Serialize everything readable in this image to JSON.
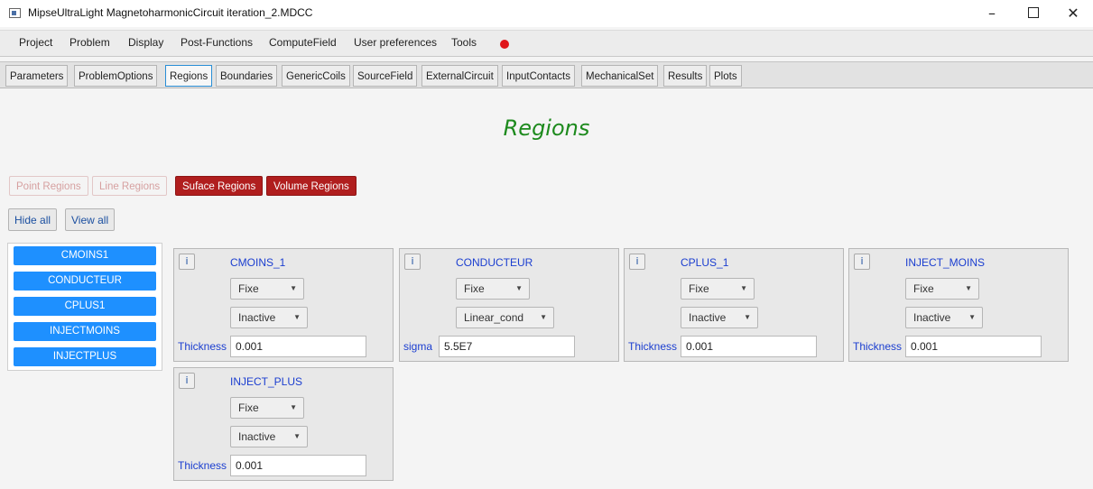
{
  "window": {
    "title": "MipseUltraLight MagnetoharmonicCircuit iteration_2.MDCC",
    "minimize": "–",
    "close": "✕"
  },
  "menu": [
    "Project",
    "Problem",
    "Display",
    "Post-Functions",
    "ComputeField",
    "User preferences",
    "Tools"
  ],
  "tabs": [
    "Parameters",
    "ProblemOptions",
    "Regions",
    "Boundaries",
    "GenericCoils",
    "SourceField",
    "ExternalCircuit",
    "InputContacts",
    "MechanicalSet",
    "Results",
    "Plots"
  ],
  "active_tab": "Regions",
  "page_title": "Regions",
  "region_type_buttons": [
    "Point Regions",
    "Line Regions",
    "Suface Regions",
    "Volume Regions"
  ],
  "visibility_buttons": [
    "Hide all",
    "View all"
  ],
  "region_list": [
    "CMOINS1",
    "CONDUCTEUR",
    "CPLUS1",
    "INJECTMOINS",
    "INJECTPLUS"
  ],
  "cards": [
    {
      "info": "i",
      "name": "CMOINS_1",
      "select1": "Fixe",
      "select2": "Inactive",
      "field_label": "Thickness",
      "field_value": "0.001"
    },
    {
      "info": "i",
      "name": "CONDUCTEUR",
      "select1": "Fixe",
      "select2": "Linear_cond",
      "field_label": "sigma",
      "field_value": "5.5E7"
    },
    {
      "info": "i",
      "name": "CPLUS_1",
      "select1": "Fixe",
      "select2": "Inactive",
      "field_label": "Thickness",
      "field_value": "0.001"
    },
    {
      "info": "i",
      "name": "INJECT_MOINS",
      "select1": "Fixe",
      "select2": "Inactive",
      "field_label": "Thickness",
      "field_value": "0.001"
    },
    {
      "info": "i",
      "name": "INJECT_PLUS",
      "select1": "Fixe",
      "select2": "Inactive",
      "field_label": "Thickness",
      "field_value": "0.001"
    }
  ],
  "colors": {
    "accent_blue": "#1e90ff",
    "region_red": "#b01e1e",
    "title_green": "#1d8a1d",
    "record_red": "#e0161b"
  }
}
